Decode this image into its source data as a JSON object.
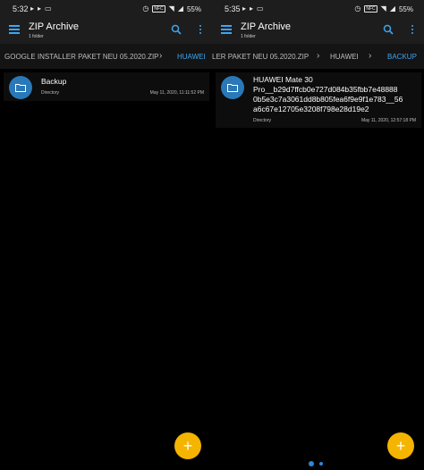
{
  "colors": {
    "accent": "#3ea6f0",
    "folder": "#2a78b8",
    "fab": "#f4b400",
    "bar": "#1d1d1d"
  },
  "screens": [
    {
      "status": {
        "time": "5:32",
        "battery": "55%"
      },
      "appbar": {
        "title": "ZIP Archive",
        "subtitle": "1 folder"
      },
      "breadcrumbs": {
        "crumb1": "GOOGLE INSTALLER PAKET NEU 05.2020.ZIP",
        "crumb2": "HUAWEI"
      },
      "item": {
        "name_line1": "Backup",
        "type": "Directory",
        "date": "May 11, 2020, 11:11:52 PM"
      }
    },
    {
      "status": {
        "time": "5:35",
        "battery": "55%"
      },
      "appbar": {
        "title": "ZIP Archive",
        "subtitle": "1 folder"
      },
      "breadcrumbs": {
        "crumb1": "LER PAKET NEU 05.2020.ZIP",
        "crumb2": "HUAWEI",
        "crumb3": "BACKUP"
      },
      "item": {
        "name_line1": "HUAWEI Mate 30",
        "name_line2": "Pro__b29d7ffcb0e727d084b35fbb7e48888",
        "name_line3": "0b5e3c7a3061dd8b805fea6f9e9f1e783__56",
        "name_line4": "a6c67e12705e3208f798e28d19e2",
        "type": "Directory",
        "date": "May 11, 2020, 12:57:18 PM"
      }
    }
  ],
  "icons": {
    "menu": "menu-icon",
    "search": "search-icon",
    "more": "more-vert-icon",
    "folder": "folder-icon",
    "fab": "add-icon",
    "chevron": "chevron-right-icon"
  }
}
